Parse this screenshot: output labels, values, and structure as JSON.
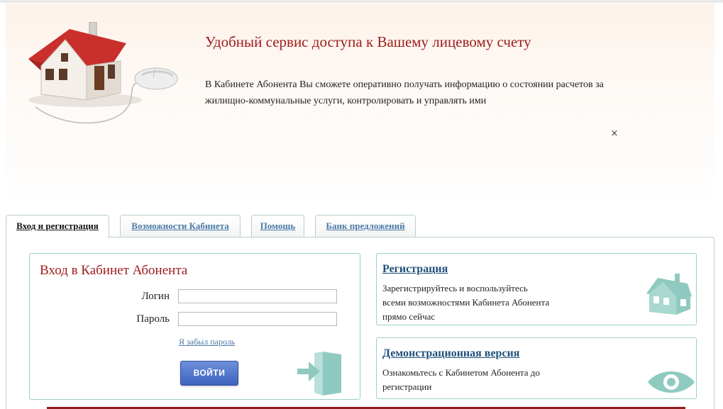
{
  "header": {
    "title": "Удобный сервис доступа к Вашему лицевому счету",
    "description": "В Кабинете Абонента Вы сможете оперативно получать информацию о состоянии расчетов за жилищно-коммунальные услуги, контролировать и управлять ими",
    "close_symbol": "×",
    "art_icon": "house-with-mouse-icon"
  },
  "tabs": [
    {
      "label": "Вход и регистрация",
      "active": true
    },
    {
      "label": "Возможности Кабинета",
      "active": false
    },
    {
      "label": "Помощь",
      "active": false
    },
    {
      "label": "Банк предложений",
      "active": false
    }
  ],
  "login": {
    "title": "Вход в Кабинет Абонента",
    "login_label": "Логин",
    "login_value": "",
    "password_label": "Пароль",
    "password_value": "",
    "forgot_link": "Я забыл пароль",
    "submit_label": "ВОЙТИ",
    "icon": "door-enter-icon"
  },
  "registration": {
    "title": "Регистрация",
    "text": "Зарегистрируйтесь и воспользуйтесь всеми возможностями Кабинета Абонента прямо сейчас",
    "icon": "house-icon"
  },
  "demo": {
    "title": "Демонстрационная версия",
    "text": "Ознакомьтесь с Кабинетом Абонента до регистрации",
    "icon": "eye-icon"
  },
  "colors": {
    "accent_red": "#9e1b1b",
    "link_blue": "#4a7aa6",
    "title_blue": "#1f4f7a",
    "teal": "#8fcac0",
    "button_blue": "#3e63bf"
  }
}
